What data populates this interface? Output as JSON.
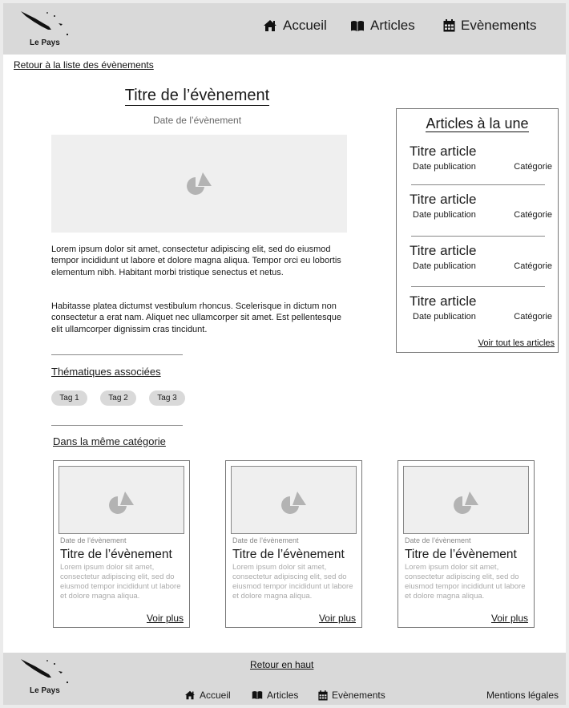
{
  "header": {
    "logo_text": "Le Pays",
    "nav": [
      {
        "label": "Accueil",
        "icon": "home-icon"
      },
      {
        "label": "Articles",
        "icon": "book-icon"
      },
      {
        "label": "Evènements",
        "icon": "calendar-icon"
      }
    ]
  },
  "back_link": "Retour à la liste des évènements",
  "event": {
    "title": "Titre de l’évènement",
    "date": "Date de l’évènement",
    "image_icon": "image-placeholder-icon",
    "paragraphs": [
      "Lorem ipsum dolor sit amet, consectetur adipiscing elit, sed do eiusmod tempor incididunt ut labore et dolore magna aliqua. Tempor orci eu lobortis elementum nibh. Habitant morbi tristique senectus et netus.",
      "Habitasse platea dictumst vestibulum rhoncus. Scelerisque in dictum non consectetur a erat nam. Aliquet nec ullamcorper sit amet. Est pellentesque elit ullamcorper dignissim cras tincidunt."
    ]
  },
  "themes": {
    "title": "Thématiques associées",
    "tags": [
      "Tag 1",
      "Tag 2",
      "Tag 3"
    ]
  },
  "related": {
    "title": "Dans la même catégorie",
    "cards": [
      {
        "date": "Date de l’évènement",
        "title": "Titre de l’évènement",
        "text": "Lorem ipsum dolor sit amet, consectetur adipiscing elit, sed do eiusmod tempor incididunt ut labore et dolore magna aliqua.",
        "more": "Voir plus"
      },
      {
        "date": "Date de l’évènement",
        "title": "Titre de l’évènement",
        "text": "Lorem ipsum dolor sit amet, consectetur adipiscing elit, sed do eiusmod tempor incididunt ut labore et dolore magna aliqua.",
        "more": "Voir plus"
      },
      {
        "date": "Date de l’évènement",
        "title": "Titre de l’évènement",
        "text": "Lorem ipsum dolor sit amet, consectetur adipiscing elit, sed do eiusmod tempor incididunt ut labore et dolore magna aliqua.",
        "more": "Voir plus"
      }
    ]
  },
  "sidebar": {
    "title": "Articles à la une",
    "articles": [
      {
        "title": "Titre article",
        "date": "Date publication",
        "category": "Catégorie"
      },
      {
        "title": "Titre article",
        "date": "Date publication",
        "category": "Catégorie"
      },
      {
        "title": "Titre article",
        "date": "Date publication",
        "category": "Catégorie"
      },
      {
        "title": "Titre article",
        "date": "Date publication",
        "category": "Catégorie"
      }
    ],
    "see_all": "Voir tout les articles"
  },
  "footer": {
    "logo_text": "Le Pays",
    "back_top": "Retour en haut",
    "nav": [
      "Accueil",
      "Articles",
      "Evènements"
    ],
    "legal": "Mentions légales"
  },
  "colors": {
    "header_bg": "#d9d9d9",
    "placeholder_bg": "#efefef",
    "tag_bg": "#d9d9d9"
  }
}
